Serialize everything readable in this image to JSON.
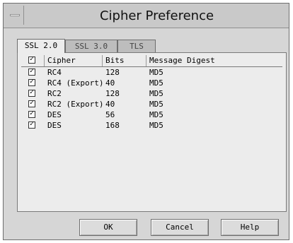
{
  "window": {
    "title": "Cipher Preference"
  },
  "tabs": [
    {
      "label": "SSL 2.0"
    },
    {
      "label": "SSL 3.0"
    },
    {
      "label": "TLS"
    }
  ],
  "table": {
    "headers": {
      "cipher": "Cipher",
      "bits": "Bits",
      "digest": "Message Digest"
    },
    "rows": [
      {
        "cipher": "RC4",
        "bits": "128",
        "digest": "MD5"
      },
      {
        "cipher": "RC4 (Export)",
        "bits": "40",
        "digest": "MD5"
      },
      {
        "cipher": "RC2",
        "bits": "128",
        "digest": "MD5"
      },
      {
        "cipher": "RC2 (Export)",
        "bits": "40",
        "digest": "MD5"
      },
      {
        "cipher": "DES",
        "bits": "56",
        "digest": "MD5"
      },
      {
        "cipher": "DES",
        "bits": "168",
        "digest": "MD5"
      }
    ]
  },
  "buttons": {
    "ok": "OK",
    "cancel": "Cancel",
    "help": "Help"
  }
}
